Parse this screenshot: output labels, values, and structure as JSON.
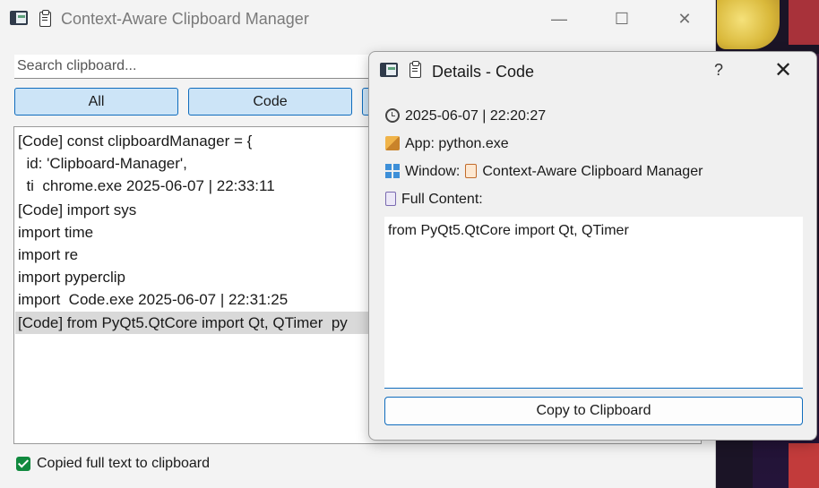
{
  "main_window": {
    "title": "Context-Aware Clipboard Manager",
    "controls": {
      "minimize": "—",
      "maximize": "☐",
      "close": "✕"
    },
    "search": {
      "placeholder": "Search clipboard...",
      "value": ""
    },
    "filters": [
      {
        "label": "All",
        "active": true
      },
      {
        "label": "Code",
        "active": true
      }
    ],
    "list_items": [
      "[Code] const clipboardManager = {",
      "  id: 'Clipboard-Manager',",
      "  ti  chrome.exe 2025-06-07 | 22:33:11",
      "[Code] import sys",
      "import time",
      "import re",
      "import pyperclip",
      "import  Code.exe 2025-06-07 | 22:31:25",
      "[Code] from PyQt5.QtCore import Qt, QTimer  py"
    ],
    "selected_index": 8,
    "status": "Copied full text to clipboard"
  },
  "details_dialog": {
    "title": "Details - Code",
    "help": "?",
    "close": "✕",
    "timestamp": "2025-06-07 | 22:20:27",
    "app": "App: python.exe",
    "window_label": "Window:",
    "window_value": "Context-Aware Clipboard Manager",
    "full_content_label": "Full Content:",
    "full_content": "from PyQt5.QtCore import Qt, QTimer",
    "copy_button": "Copy to Clipboard"
  },
  "colors": {
    "accent": "#0f6cbd",
    "button_active_bg": "#cce4f7",
    "success": "#10893e"
  }
}
